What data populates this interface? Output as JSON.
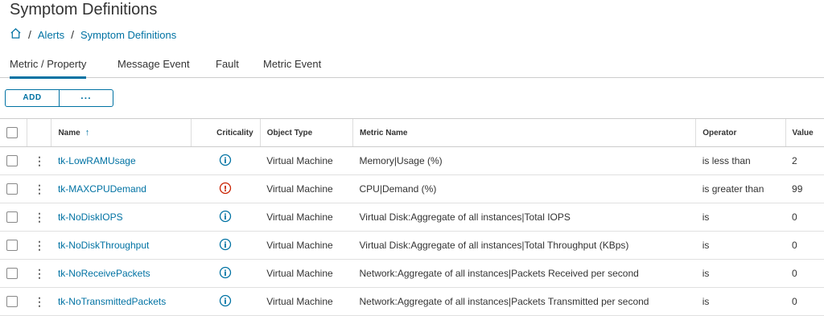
{
  "page": {
    "title": "Symptom Definitions"
  },
  "breadcrumb": {
    "home_icon": "home-icon",
    "items": [
      "Alerts",
      "Symptom Definitions"
    ],
    "separator": "/"
  },
  "tabs": [
    {
      "label": "Metric / Property",
      "active": true
    },
    {
      "label": "Message Event",
      "active": false
    },
    {
      "label": "Fault",
      "active": false
    },
    {
      "label": "Metric Event",
      "active": false
    }
  ],
  "toolbar": {
    "add_label": "ADD",
    "more_label": "···"
  },
  "table": {
    "columns": {
      "name": "Name",
      "criticality": "Criticality",
      "object_type": "Object Type",
      "metric_name": "Metric Name",
      "operator": "Operator",
      "value": "Value"
    },
    "sort_icon": "arrow-up-icon",
    "rows": [
      {
        "name": "tk-LowRAMUsage",
        "criticality": "info",
        "object_type": "Virtual Machine",
        "metric_name": "Memory|Usage (%)",
        "operator": "is less than",
        "value": "2"
      },
      {
        "name": "tk-MAXCPUDemand",
        "criticality": "critical",
        "object_type": "Virtual Machine",
        "metric_name": "CPU|Demand (%)",
        "operator": "is greater than",
        "value": "99"
      },
      {
        "name": "tk-NoDiskIOPS",
        "criticality": "info",
        "object_type": "Virtual Machine",
        "metric_name": "Virtual Disk:Aggregate of all instances|Total IOPS",
        "operator": "is",
        "value": "0"
      },
      {
        "name": "tk-NoDiskThroughput",
        "criticality": "info",
        "object_type": "Virtual Machine",
        "metric_name": "Virtual Disk:Aggregate of all instances|Total Throughput (KBps)",
        "operator": "is",
        "value": "0"
      },
      {
        "name": "tk-NoReceivePackets",
        "criticality": "info",
        "object_type": "Virtual Machine",
        "metric_name": "Network:Aggregate of all instances|Packets Received per second",
        "operator": "is",
        "value": "0"
      },
      {
        "name": "tk-NoTransmittedPackets",
        "criticality": "info",
        "object_type": "Virtual Machine",
        "metric_name": "Network:Aggregate of all instances|Packets Transmitted per second",
        "operator": "is",
        "value": "0"
      }
    ]
  },
  "colors": {
    "accent": "#0072a3",
    "critical": "#c92100",
    "info": "#0072a3"
  }
}
